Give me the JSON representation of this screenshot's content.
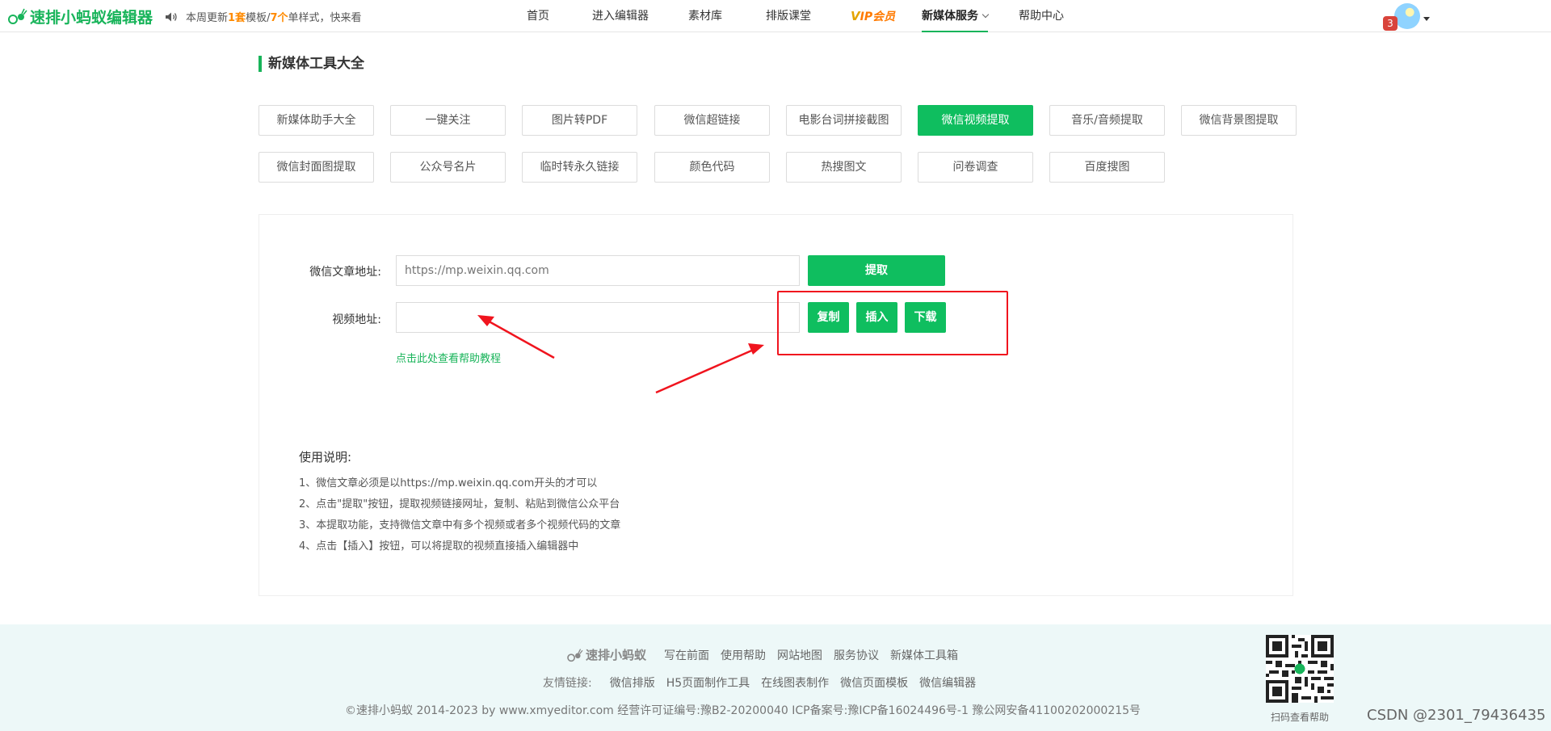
{
  "header": {
    "logo_text": "速排小蚂蚁编辑器",
    "notice_prefix": "本周更新",
    "notice_count1": "1套",
    "notice_mid": "模板/",
    "notice_count2": "7个",
    "notice_suffix": "单样式，快来看",
    "nav": {
      "home": "首页",
      "editor": "进入编辑器",
      "materials": "素材库",
      "classroom": "排版课堂",
      "vip_v": "V",
      "vip": "IP会员",
      "newmedia": "新媒体服务",
      "help": "帮助中心"
    },
    "notification_count": "3"
  },
  "page": {
    "section_title": "新媒体工具大全",
    "tools_row1": [
      "新媒体助手大全",
      "一键关注",
      "图片转PDF",
      "微信超链接",
      "电影台词拼接截图",
      "微信视频提取",
      "音乐/音频提取",
      "微信背景图提取"
    ],
    "tools_row2": [
      "微信封面图提取",
      "公众号名片",
      "临时转永久链接",
      "颜色代码",
      "热搜图文",
      "问卷调查",
      "百度搜图"
    ],
    "active_tool": "微信视频提取"
  },
  "form": {
    "article_label": "微信文章地址:",
    "article_placeholder": "https://mp.weixin.qq.com",
    "extract_button": "提取",
    "video_label": "视频地址:",
    "video_value": "",
    "copy_button": "复制",
    "insert_button": "插入",
    "download_button": "下载",
    "help_link": "点击此处查看帮助教程"
  },
  "usage": {
    "title": "使用说明:",
    "lines": [
      "1、微信文章必须是以https://mp.weixin.qq.com开头的才可以",
      "2、点击\"提取\"按钮，提取视频链接网址，复制、粘贴到微信公众平台",
      "3、本提取功能，支持微信文章中有多个视频或者多个视频代码的文章",
      "4、点击【插入】按钮，可以将提取的视频直接插入编辑器中"
    ]
  },
  "footer": {
    "logo_text": "速排小蚂蚁",
    "links": [
      "写在前面",
      "使用帮助",
      "网站地图",
      "服务协议",
      "新媒体工具箱"
    ],
    "friend_label": "友情链接:",
    "friend_links": [
      "微信排版",
      "H5页面制作工具",
      "在线图表制作",
      "微信页面模板",
      "微信编辑器"
    ],
    "copyright": "©速排小蚂蚁 2014-2023 by www.xmyeditor.com   经营许可证编号:豫B2-20200040   ICP备案号:豫ICP备16024496号-1   豫公网安备41100202000215号",
    "qr_caption": "扫码查看帮助"
  },
  "watermark": "CSDN @2301_79436435",
  "colors": {
    "accent": "#0fbe5f",
    "annotation": "#f0141e",
    "vip": "#ff7a00"
  }
}
